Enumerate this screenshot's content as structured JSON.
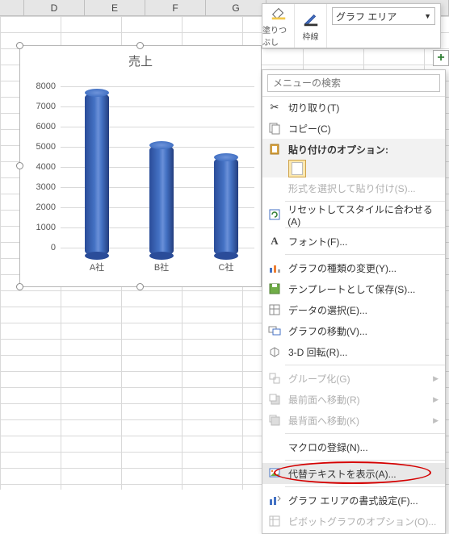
{
  "columns": [
    "D",
    "E",
    "F",
    "G"
  ],
  "mini_toolbar": {
    "fill_label": "塗りつぶし",
    "outline_label": "枠線",
    "select_value": "グラフ エリア"
  },
  "chart": {
    "title": "売上"
  },
  "chart_data": {
    "type": "bar",
    "title": "売上",
    "categories": [
      "A社",
      "B社",
      "C社"
    ],
    "values": [
      8100,
      5500,
      4900
    ],
    "ylim": [
      0,
      8000
    ],
    "yticks": [
      0,
      1000,
      2000,
      3000,
      4000,
      5000,
      6000,
      7000,
      8000
    ],
    "xlabel": "",
    "ylabel": ""
  },
  "menu": {
    "search_placeholder": "メニューの検索",
    "cut": "切り取り(T)",
    "copy": "コピー(C)",
    "paste_opts_h": "貼り付けのオプション:",
    "paste_special": "形式を選択して貼り付け(S)...",
    "reset_style": "リセットしてスタイルに合わせる(A)",
    "font": "フォント(F)...",
    "change_type": "グラフの種類の変更(Y)...",
    "save_template": "テンプレートとして保存(S)...",
    "select_data": "データの選択(E)...",
    "move_chart": "グラフの移動(V)...",
    "rotate3d": "3-D 回転(R)...",
    "group": "グループ化(G)",
    "bring_front": "最前面へ移動(R)",
    "send_back": "最背面へ移動(K)",
    "assign_macro": "マクロの登録(N)...",
    "alt_text": "代替テキストを表示(A)...",
    "format_area": "グラフ エリアの書式設定(F)...",
    "pivot_opts": "ピボットグラフのオプション(O)..."
  }
}
